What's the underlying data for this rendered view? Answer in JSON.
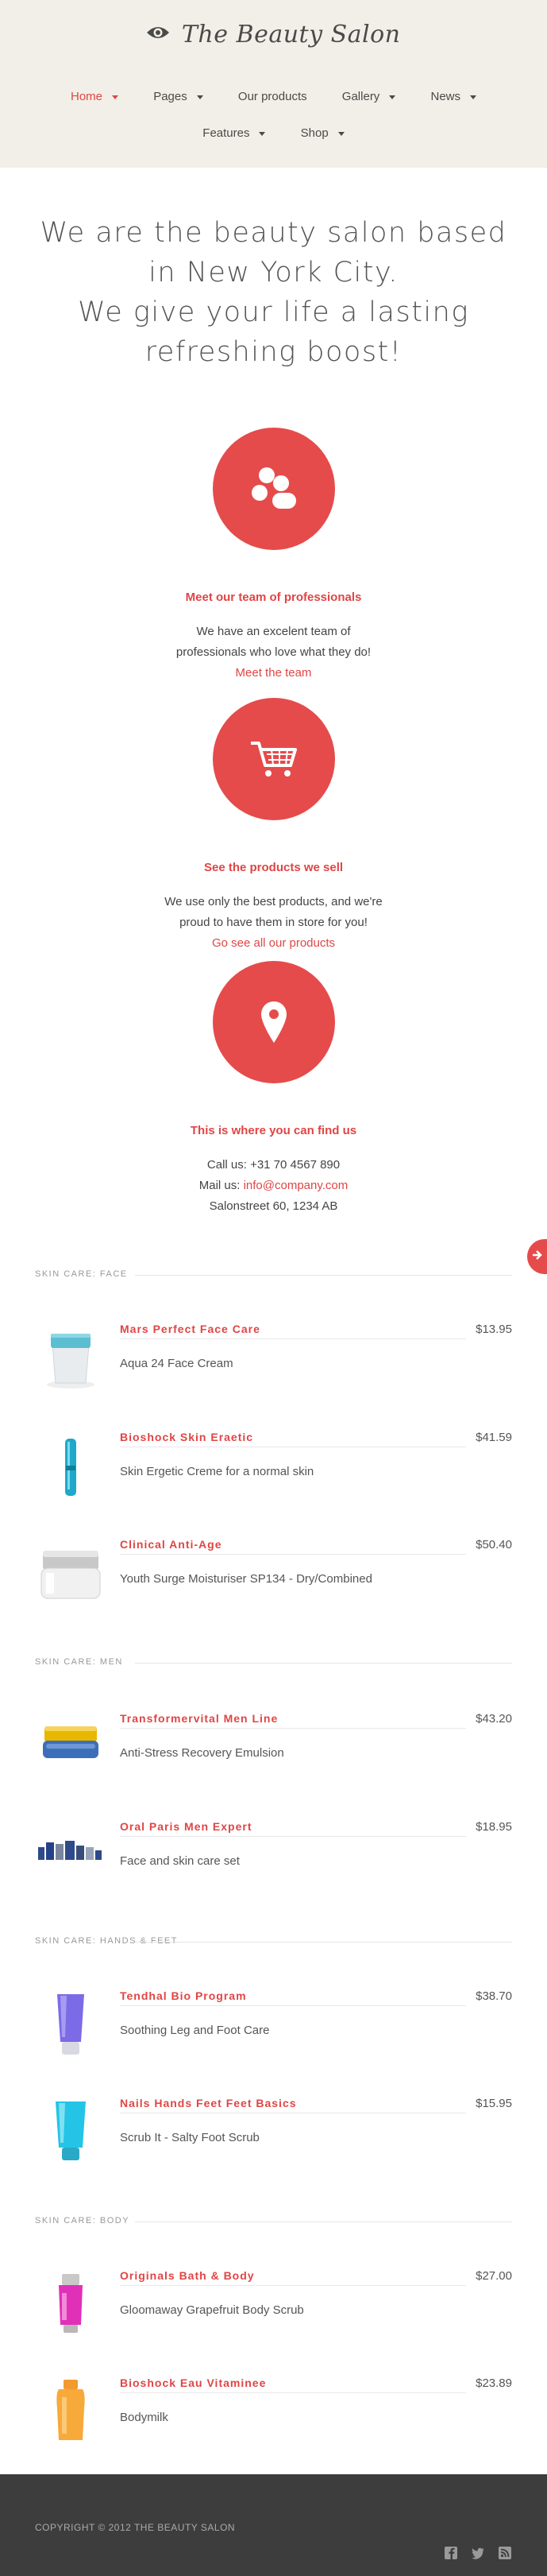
{
  "site": {
    "title": "The Beauty Salon"
  },
  "nav": {
    "row1": [
      {
        "label": "Home",
        "dropdown": true,
        "active": true
      },
      {
        "label": "Pages",
        "dropdown": true,
        "active": false
      },
      {
        "label": "Our products",
        "dropdown": false,
        "active": false
      },
      {
        "label": "Gallery",
        "dropdown": true,
        "active": false
      },
      {
        "label": "News",
        "dropdown": true,
        "active": false
      }
    ],
    "row2": [
      {
        "label": "Features",
        "dropdown": true,
        "active": false
      },
      {
        "label": "Shop",
        "dropdown": true,
        "active": false
      }
    ]
  },
  "hero": {
    "line1": "We are the beauty salon based",
    "line2": "in New York City.",
    "line3": "We give your life a lasting",
    "line4": "refreshing boost!"
  },
  "features": {
    "team": {
      "icon": "team-icon",
      "title": "Meet our team of professionals",
      "text1": "We have an excelent team of",
      "text2": "professionals who love what they do!",
      "link": "Meet the team"
    },
    "products": {
      "icon": "cart-icon",
      "title": "See the products we sell",
      "text1": "We use only the best products, and we're",
      "text2": "proud to have them in store for you!",
      "link": "Go see all our products"
    },
    "location": {
      "icon": "map-pin-icon",
      "title": "This is where you can find us",
      "phone": "Call us: +31 70 4567 890",
      "mail_label": "Mail us: ",
      "mail": "info@company.com",
      "address": "Salonstreet 60, 1234 AB"
    }
  },
  "sections": {
    "face": {
      "label": "SKIN CARE: FACE",
      "items": [
        {
          "name": "Mars Perfect Face Care",
          "desc": "Aqua 24 Face Cream",
          "price": "$13.95"
        },
        {
          "name": "Bioshock Skin Eraetic",
          "desc": "Skin Ergetic Creme for a normal skin",
          "price": "$41.59"
        },
        {
          "name": "Clinical Anti-Age",
          "desc": "Youth Surge Moisturiser SP134 - Dry/Combined",
          "price": "$50.40"
        }
      ]
    },
    "men": {
      "label": "SKIN CARE: MEN",
      "items": [
        {
          "name": "Transformervital Men Line",
          "desc": "Anti-Stress Recovery Emulsion",
          "price": "$43.20"
        },
        {
          "name": "Oral Paris Men Expert",
          "desc": "Face and skin care set",
          "price": "$18.95"
        }
      ]
    },
    "hands": {
      "label": "SKIN CARE: HANDS & FEET",
      "items": [
        {
          "name": "Tendhal Bio Program",
          "desc": "Soothing Leg and Foot Care",
          "price": "$38.70"
        },
        {
          "name": "Nails Hands Feet Feet Basics",
          "desc": "Scrub It - Salty Foot Scrub",
          "price": "$15.95"
        }
      ]
    },
    "body": {
      "label": "SKIN CARE: BODY",
      "items": [
        {
          "name": "Originals Bath & Body",
          "desc": "Gloomaway Grapefruit Body Scrub",
          "price": "$27.00"
        },
        {
          "name": "Bioshock Eau Vitaminee",
          "desc": "Bodymilk",
          "price": "$23.89"
        }
      ]
    }
  },
  "footer": {
    "copyright": "COPYRIGHT © 2012 THE BEAUTY SALON",
    "icons": [
      "facebook-icon",
      "twitter-icon",
      "rss-icon"
    ]
  },
  "colors": {
    "accent": "#e54b4b",
    "header_bg": "#f2efe8",
    "footer_bg": "#3d3d3d"
  }
}
